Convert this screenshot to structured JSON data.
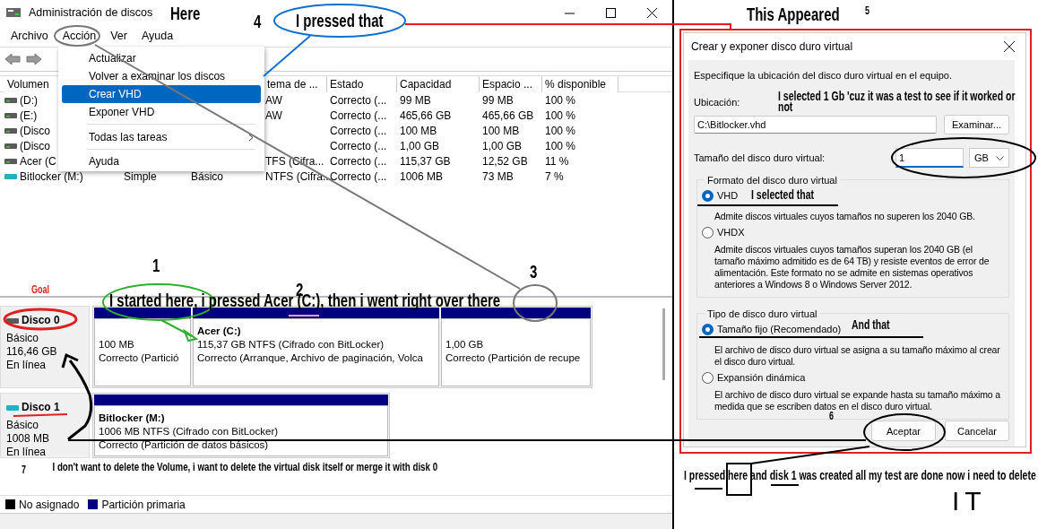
{
  "window": {
    "title": "Administración de discos",
    "menu": [
      "Archivo",
      "Acción",
      "Ver",
      "Ayuda"
    ]
  },
  "action_menu": {
    "items": [
      {
        "kind": "item",
        "label": "Actualizar",
        "selected": false,
        "submenu": false
      },
      {
        "kind": "item",
        "label": "Volver a examinar los discos",
        "selected": false,
        "submenu": false
      },
      {
        "kind": "item",
        "label": "Crear VHD",
        "selected": true,
        "submenu": false
      },
      {
        "kind": "item",
        "label": "Exponer VHD",
        "selected": false,
        "submenu": false
      },
      {
        "kind": "separator"
      },
      {
        "kind": "item",
        "label": "Todas las tareas",
        "selected": false,
        "submenu": true
      },
      {
        "kind": "separator"
      },
      {
        "kind": "item",
        "label": "Ayuda",
        "selected": false,
        "submenu": false
      }
    ]
  },
  "volume_table": {
    "columns": [
      "Volumen",
      "tema de ...",
      "Estado",
      "Capacidad",
      "Espacio ...",
      "% disponible"
    ],
    "rows": [
      {
        "kind": "drive",
        "volume": "(D:)",
        "column_4": "AW",
        "status": "Correcto (...",
        "capacity": "99 MB",
        "column_7": "99 MB",
        "percent_available": "100 %"
      },
      {
        "kind": "drive",
        "volume": "(E:)",
        "column_4": "AW",
        "status": "Correcto (...",
        "capacity": "465,66 GB",
        "column_7": "465,66 GB",
        "percent_available": "100 %"
      },
      {
        "kind": "drive",
        "volume": "(Disco",
        "status": "Correcto (...",
        "capacity": "100 MB",
        "column_7": "100 MB",
        "percent_available": "100 %"
      },
      {
        "kind": "drive",
        "volume": "(Disco",
        "status": "Correcto (...",
        "capacity": "1,00 GB",
        "column_7": "1,00 GB",
        "percent_available": "100 %"
      },
      {
        "kind": "drive",
        "volume": "Acer (C",
        "column_4": "TFS (Cifra...",
        "status": "Correcto (...",
        "capacity": "115,37 GB",
        "column_7": "12,52 GB",
        "percent_available": "11 %"
      },
      {
        "kind": "virtual-drive",
        "volume": "Bitlocker (M:)",
        "column_2": "Simple",
        "column_3": "Básico",
        "column_4": "NTFS (Cifra...",
        "status": "Correcto (...",
        "capacity": "1006 MB",
        "column_7": "73 MB",
        "percent_available": "7 %"
      }
    ]
  },
  "disks": [
    {
      "kind": "physical",
      "name": "Disco 0",
      "type": "Básico",
      "size": "116,46 GB",
      "state": "En línea",
      "partitions": [
        {
          "lines": [
            "100 MB",
            "Correcto (Partició"
          ]
        },
        {
          "name": "Acer  (C:)",
          "lines": [
            "115,37 GB NTFS (Cifrado con BitLocker)",
            "Correcto (Arranque, Archivo de paginación, Volca"
          ]
        },
        {
          "lines": [
            "1,00 GB",
            "Correcto (Partición de recupe"
          ]
        }
      ]
    },
    {
      "kind": "virtual",
      "name": "Disco 1",
      "type": "Básico",
      "size": "1008 MB",
      "state": "En línea",
      "partitions": [
        {
          "name": "Bitlocker  (M:)",
          "lines": [
            "1006 MB NTFS (Cifrado con BitLocker)",
            "Correcto (Partición de datos básicos)"
          ]
        }
      ]
    }
  ],
  "legend": [
    {
      "label": "No asignado",
      "color": "#000000"
    },
    {
      "label": "Partición primaria",
      "color": "#000080"
    }
  ],
  "dialog": {
    "title": "Crear y exponer disco duro virtual",
    "instruction": "Especifique la ubicación del disco duro virtual en el equipo.",
    "location_label": "Ubicación:",
    "location_value": "C:\\Bitlocker.vhd",
    "browse_button": "Examinar...",
    "size_label": "Tamaño del disco duro virtual:",
    "size_value": "1",
    "size_unit": "GB",
    "format": {
      "title": "Formato del disco duro virtual",
      "options": [
        {
          "label": "VHD",
          "selected": true,
          "description": "Admite discos virtuales cuyos tamaños no superen los 2040 GB."
        },
        {
          "label": "VHDX",
          "selected": false,
          "description": "Admite discos virtuales cuyos tamaños superan los 2040 GB (el tamaño máximo admitido es de 64 TB) y resiste eventos de error de alimentación. Este formato no se admite en sistemas operativos anteriores a Windows 8 o Windows Server 2012."
        }
      ]
    },
    "disk_type": {
      "title": "Tipo de disco duro virtual",
      "options": [
        {
          "label": "Tamaño fijo (Recomendado)",
          "selected": true,
          "description": "El archivo de disco duro virtual se asigna a su tamaño máximo al crear el disco duro virtual."
        },
        {
          "label": "Expansión dinámica",
          "selected": false,
          "description": "El archivo de disco duro virtual se expande hasta su tamaño máximo a medida que se escriben datos en el disco duro virtual."
        }
      ]
    },
    "buttons": [
      "Aceptar",
      "Cancelar"
    ]
  },
  "annotations": [
    {
      "kind": "heading",
      "text": "Here"
    },
    {
      "kind": "number",
      "text": "4"
    },
    {
      "kind": "heading",
      "text": "I pressed that"
    },
    {
      "kind": "heading",
      "text": "This Appeared"
    },
    {
      "kind": "small-number",
      "text": "5"
    },
    {
      "kind": "note",
      "text": "I selected 1 Gb 'cuz it was a test to see if it worked or not"
    },
    {
      "kind": "note",
      "text": "I selected that"
    },
    {
      "kind": "number",
      "text": "1"
    },
    {
      "kind": "number",
      "text": "3"
    },
    {
      "kind": "goal",
      "text": "Goal"
    },
    {
      "kind": "number",
      "text": "2"
    },
    {
      "kind": "heading",
      "text": "I started here, i pressed Acer (C:), then i went right over there"
    },
    {
      "kind": "note",
      "text": "And that"
    },
    {
      "kind": "small-number",
      "text": "6"
    },
    {
      "kind": "small-number",
      "text": "7"
    },
    {
      "kind": "boxed-note",
      "text": "I don't want to delete the Volume, i want to delete the virtual disk itself or merge it with disk 0"
    },
    {
      "kind": "note",
      "text": "I pressed here and disk 1 was created all my test are done now i need to delete"
    },
    {
      "kind": "handwriting",
      "text": "IT"
    }
  ]
}
